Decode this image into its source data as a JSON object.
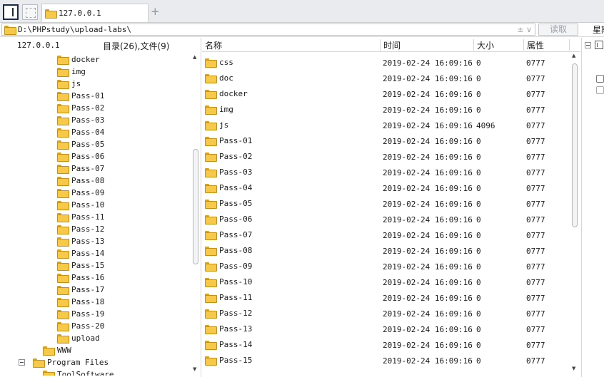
{
  "tab": {
    "title": "127.0.0.1",
    "new_tab": "+"
  },
  "address": {
    "path": "D:\\PHPstudy\\upload-labs\\",
    "controls": "± ∨",
    "read_button": "读取",
    "week_label": "星期"
  },
  "tree": {
    "host": "127.0.0.1",
    "counts": "目录(26),文件(9)",
    "items": [
      {
        "label": "docker",
        "indent": 80
      },
      {
        "label": "img",
        "indent": 80
      },
      {
        "label": "js",
        "indent": 80
      },
      {
        "label": "Pass-01",
        "indent": 80
      },
      {
        "label": "Pass-02",
        "indent": 80
      },
      {
        "label": "Pass-03",
        "indent": 80
      },
      {
        "label": "Pass-04",
        "indent": 80
      },
      {
        "label": "Pass-05",
        "indent": 80
      },
      {
        "label": "Pass-06",
        "indent": 80
      },
      {
        "label": "Pass-07",
        "indent": 80
      },
      {
        "label": "Pass-08",
        "indent": 80
      },
      {
        "label": "Pass-09",
        "indent": 80
      },
      {
        "label": "Pass-10",
        "indent": 80
      },
      {
        "label": "Pass-11",
        "indent": 80
      },
      {
        "label": "Pass-12",
        "indent": 80
      },
      {
        "label": "Pass-13",
        "indent": 80
      },
      {
        "label": "Pass-14",
        "indent": 80
      },
      {
        "label": "Pass-15",
        "indent": 80
      },
      {
        "label": "Pass-16",
        "indent": 80
      },
      {
        "label": "Pass-17",
        "indent": 80
      },
      {
        "label": "Pass-18",
        "indent": 80
      },
      {
        "label": "Pass-19",
        "indent": 80
      },
      {
        "label": "Pass-20",
        "indent": 80
      },
      {
        "label": "upload",
        "indent": 80
      },
      {
        "label": "WWW",
        "indent": 60
      },
      {
        "label": "Program Files",
        "indent": 26,
        "expanded": true
      },
      {
        "label": "ToolSoftware",
        "indent": 60
      }
    ]
  },
  "list": {
    "columns": {
      "name": "名称",
      "time": "时间",
      "size": "大小",
      "attr": "属性"
    },
    "rows": [
      {
        "name": "css",
        "time": "2019-02-24 16:09:16",
        "size": "0",
        "attr": "0777"
      },
      {
        "name": "doc",
        "time": "2019-02-24 16:09:16",
        "size": "0",
        "attr": "0777"
      },
      {
        "name": "docker",
        "time": "2019-02-24 16:09:16",
        "size": "0",
        "attr": "0777"
      },
      {
        "name": "img",
        "time": "2019-02-24 16:09:16",
        "size": "0",
        "attr": "0777"
      },
      {
        "name": "js",
        "time": "2019-02-24 16:09:16",
        "size": "4096",
        "attr": "0777"
      },
      {
        "name": "Pass-01",
        "time": "2019-02-24 16:09:16",
        "size": "0",
        "attr": "0777"
      },
      {
        "name": "Pass-02",
        "time": "2019-02-24 16:09:16",
        "size": "0",
        "attr": "0777"
      },
      {
        "name": "Pass-03",
        "time": "2019-02-24 16:09:16",
        "size": "0",
        "attr": "0777"
      },
      {
        "name": "Pass-04",
        "time": "2019-02-24 16:09:16",
        "size": "0",
        "attr": "0777"
      },
      {
        "name": "Pass-05",
        "time": "2019-02-24 16:09:16",
        "size": "0",
        "attr": "0777"
      },
      {
        "name": "Pass-06",
        "time": "2019-02-24 16:09:16",
        "size": "0",
        "attr": "0777"
      },
      {
        "name": "Pass-07",
        "time": "2019-02-24 16:09:16",
        "size": "0",
        "attr": "0777"
      },
      {
        "name": "Pass-08",
        "time": "2019-02-24 16:09:16",
        "size": "0",
        "attr": "0777"
      },
      {
        "name": "Pass-09",
        "time": "2019-02-24 16:09:16",
        "size": "0",
        "attr": "0777"
      },
      {
        "name": "Pass-10",
        "time": "2019-02-24 16:09:16",
        "size": "0",
        "attr": "0777"
      },
      {
        "name": "Pass-11",
        "time": "2019-02-24 16:09:16",
        "size": "0",
        "attr": "0777"
      },
      {
        "name": "Pass-12",
        "time": "2019-02-24 16:09:16",
        "size": "0",
        "attr": "0777"
      },
      {
        "name": "Pass-13",
        "time": "2019-02-24 16:09:16",
        "size": "0",
        "attr": "0777"
      },
      {
        "name": "Pass-14",
        "time": "2019-02-24 16:09:16",
        "size": "0",
        "attr": "0777"
      },
      {
        "name": "Pass-15",
        "time": "2019-02-24 16:09:16",
        "size": "0",
        "attr": "0777"
      }
    ]
  },
  "icons": {
    "folder": "folder-icon",
    "panel_toggle": "panel-toggle-icon",
    "expander": "collapse-icon"
  }
}
